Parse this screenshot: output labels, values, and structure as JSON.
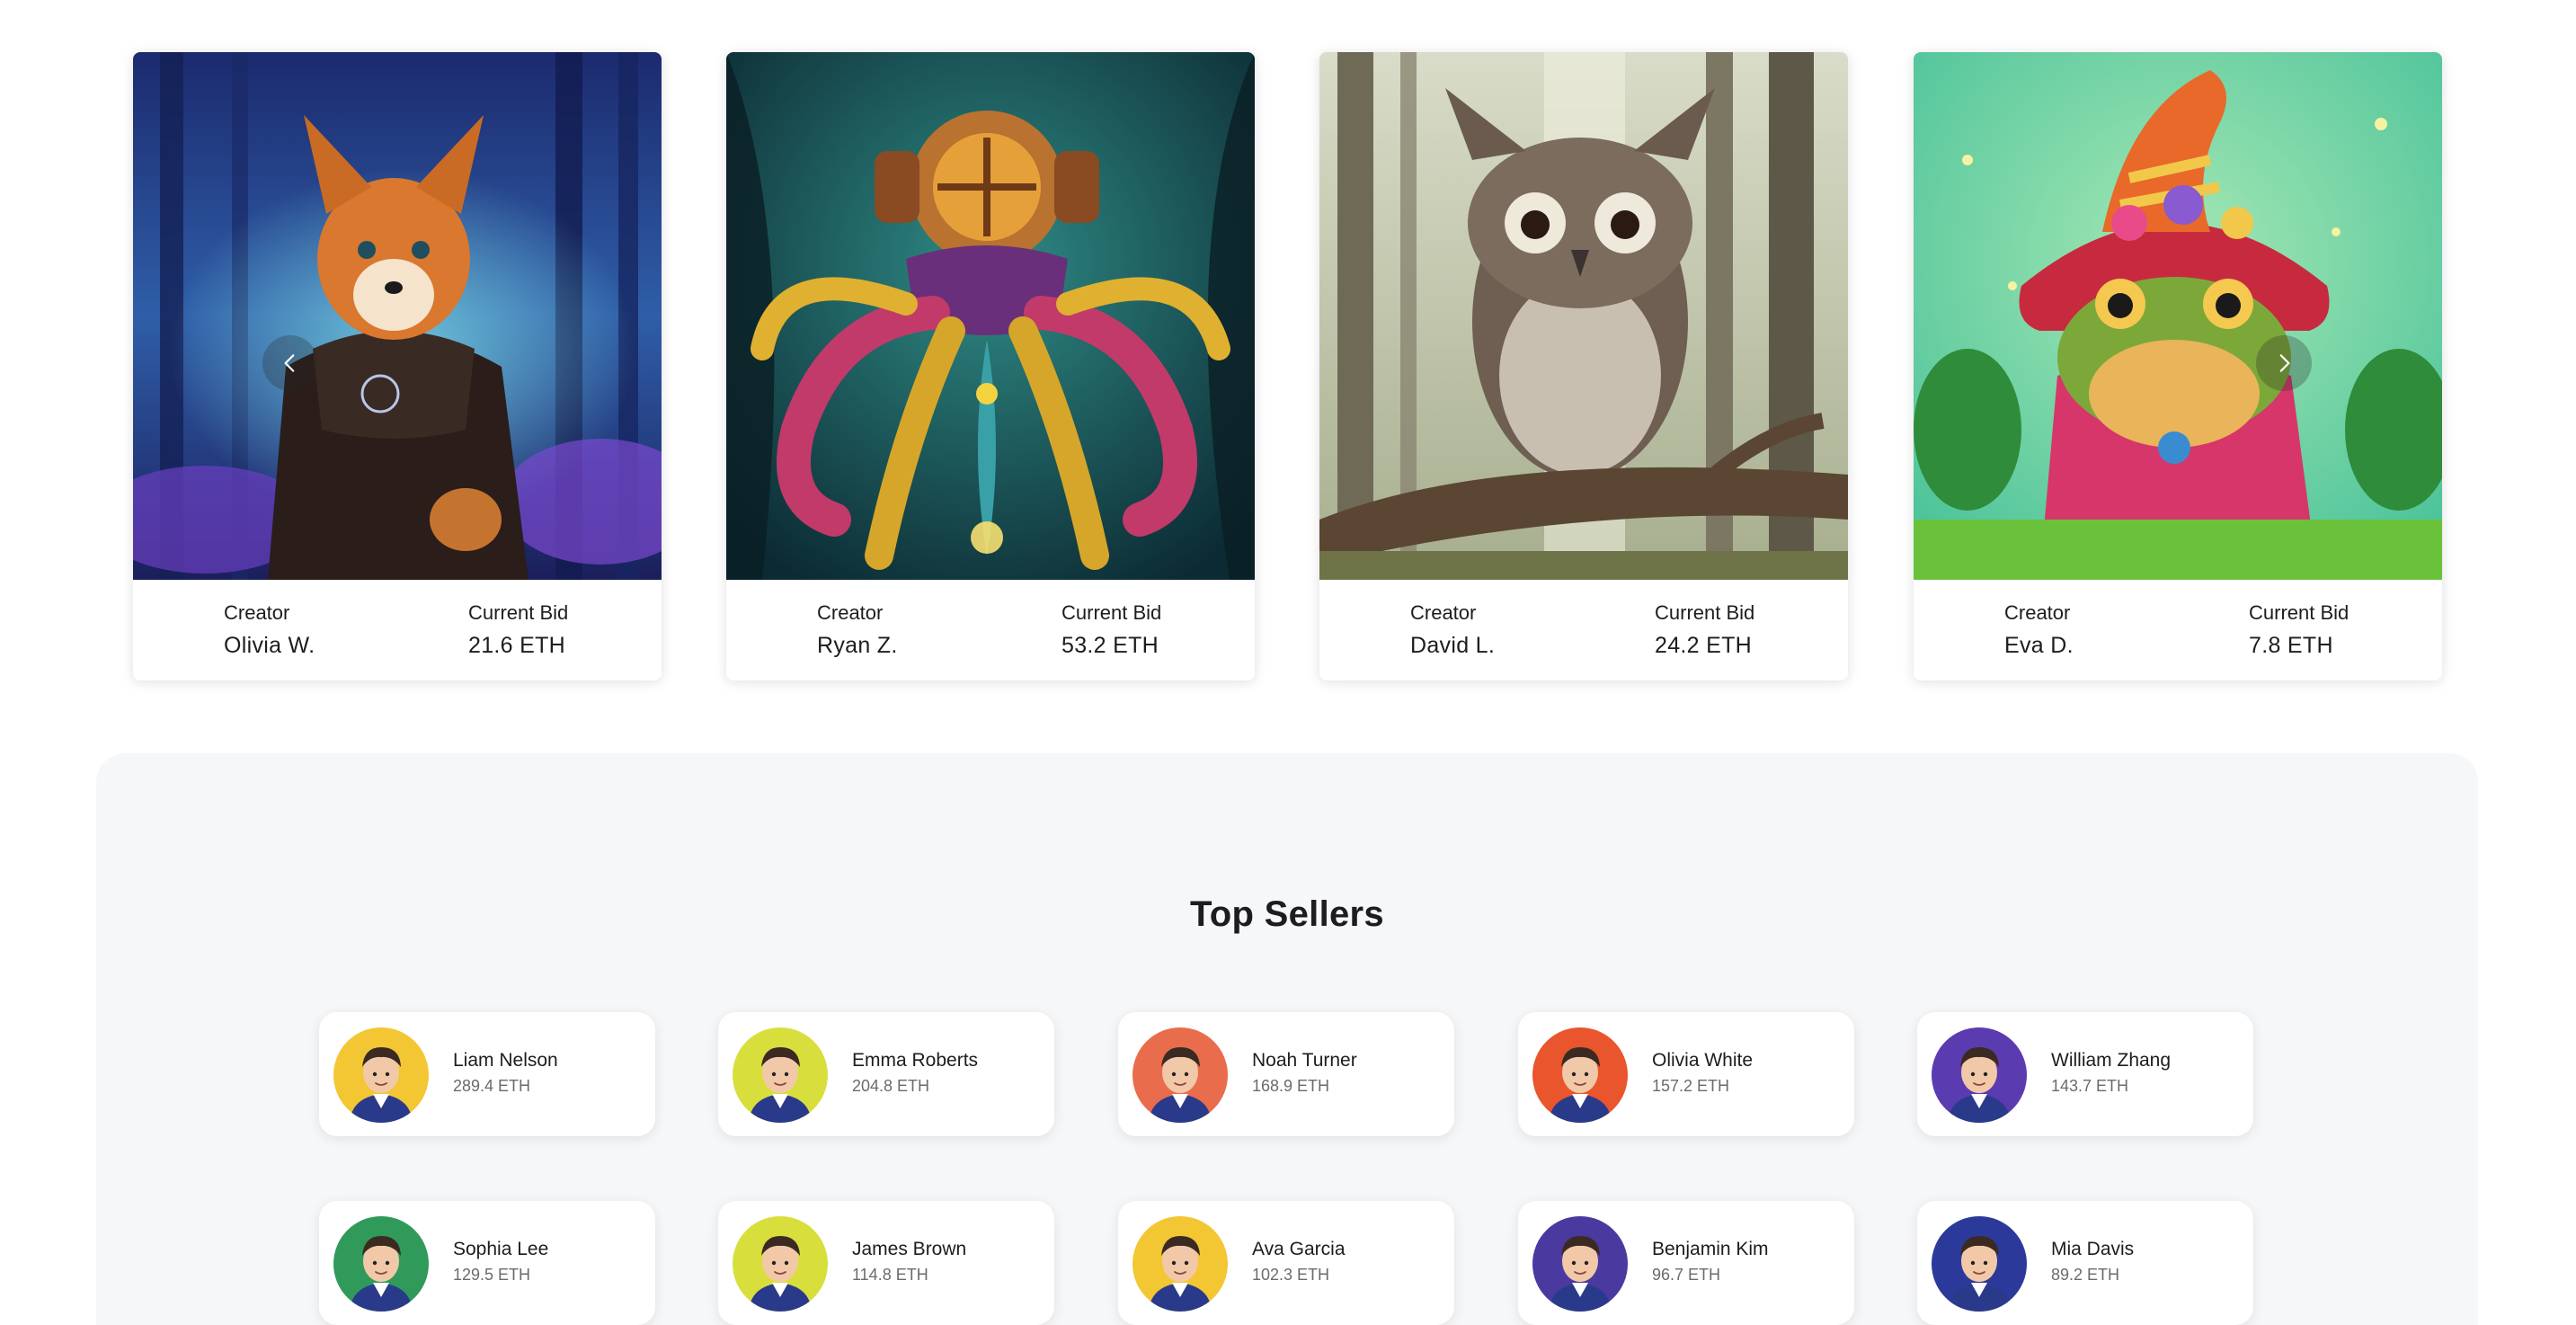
{
  "carousel": {
    "items": [
      {
        "art": "fox-in-cloak-forest",
        "creator_label": "Creator",
        "creator": "Olivia W.",
        "bid_label": "Current Bid",
        "bid": "21.6 ETH"
      },
      {
        "art": "psychedelic-octopus-diving-helmet",
        "creator_label": "Creator",
        "creator": "Ryan Z.",
        "bid_label": "Current Bid",
        "bid": "53.2 ETH"
      },
      {
        "art": "owl-on-branch-forest",
        "creator_label": "Creator",
        "creator": "David L.",
        "bid_label": "Current Bid",
        "bid": "24.2 ETH"
      },
      {
        "art": "frog-wizard-hat-pond",
        "creator_label": "Creator",
        "creator": "Eva D.",
        "bid_label": "Current Bid",
        "bid": "7.8 ETH"
      }
    ],
    "prev_icon": "chevron-left-icon",
    "next_icon": "chevron-right-icon"
  },
  "top_sellers": {
    "title": "Top Sellers",
    "sellers": [
      {
        "name": "Liam Nelson",
        "amount": "289.4 ETH",
        "avatar_bg": "#f3c633"
      },
      {
        "name": "Emma Roberts",
        "amount": "204.8 ETH",
        "avatar_bg": "#d8df3c"
      },
      {
        "name": "Noah Turner",
        "amount": "168.9 ETH",
        "avatar_bg": "#e96d4c"
      },
      {
        "name": "Olivia White",
        "amount": "157.2 ETH",
        "avatar_bg": "#e9552c"
      },
      {
        "name": "William Zhang",
        "amount": "143.7 ETH",
        "avatar_bg": "#5b3bb0"
      },
      {
        "name": "Sophia Lee",
        "amount": "129.5 ETH",
        "avatar_bg": "#2f9a5a"
      },
      {
        "name": "James Brown",
        "amount": "114.8 ETH",
        "avatar_bg": "#d8df3c"
      },
      {
        "name": "Ava Garcia",
        "amount": "102.3 ETH",
        "avatar_bg": "#f3c633"
      },
      {
        "name": "Benjamin Kim",
        "amount": "96.7 ETH",
        "avatar_bg": "#4a3aa0"
      },
      {
        "name": "Mia Davis",
        "amount": "89.2 ETH",
        "avatar_bg": "#2b3a9a"
      }
    ]
  }
}
